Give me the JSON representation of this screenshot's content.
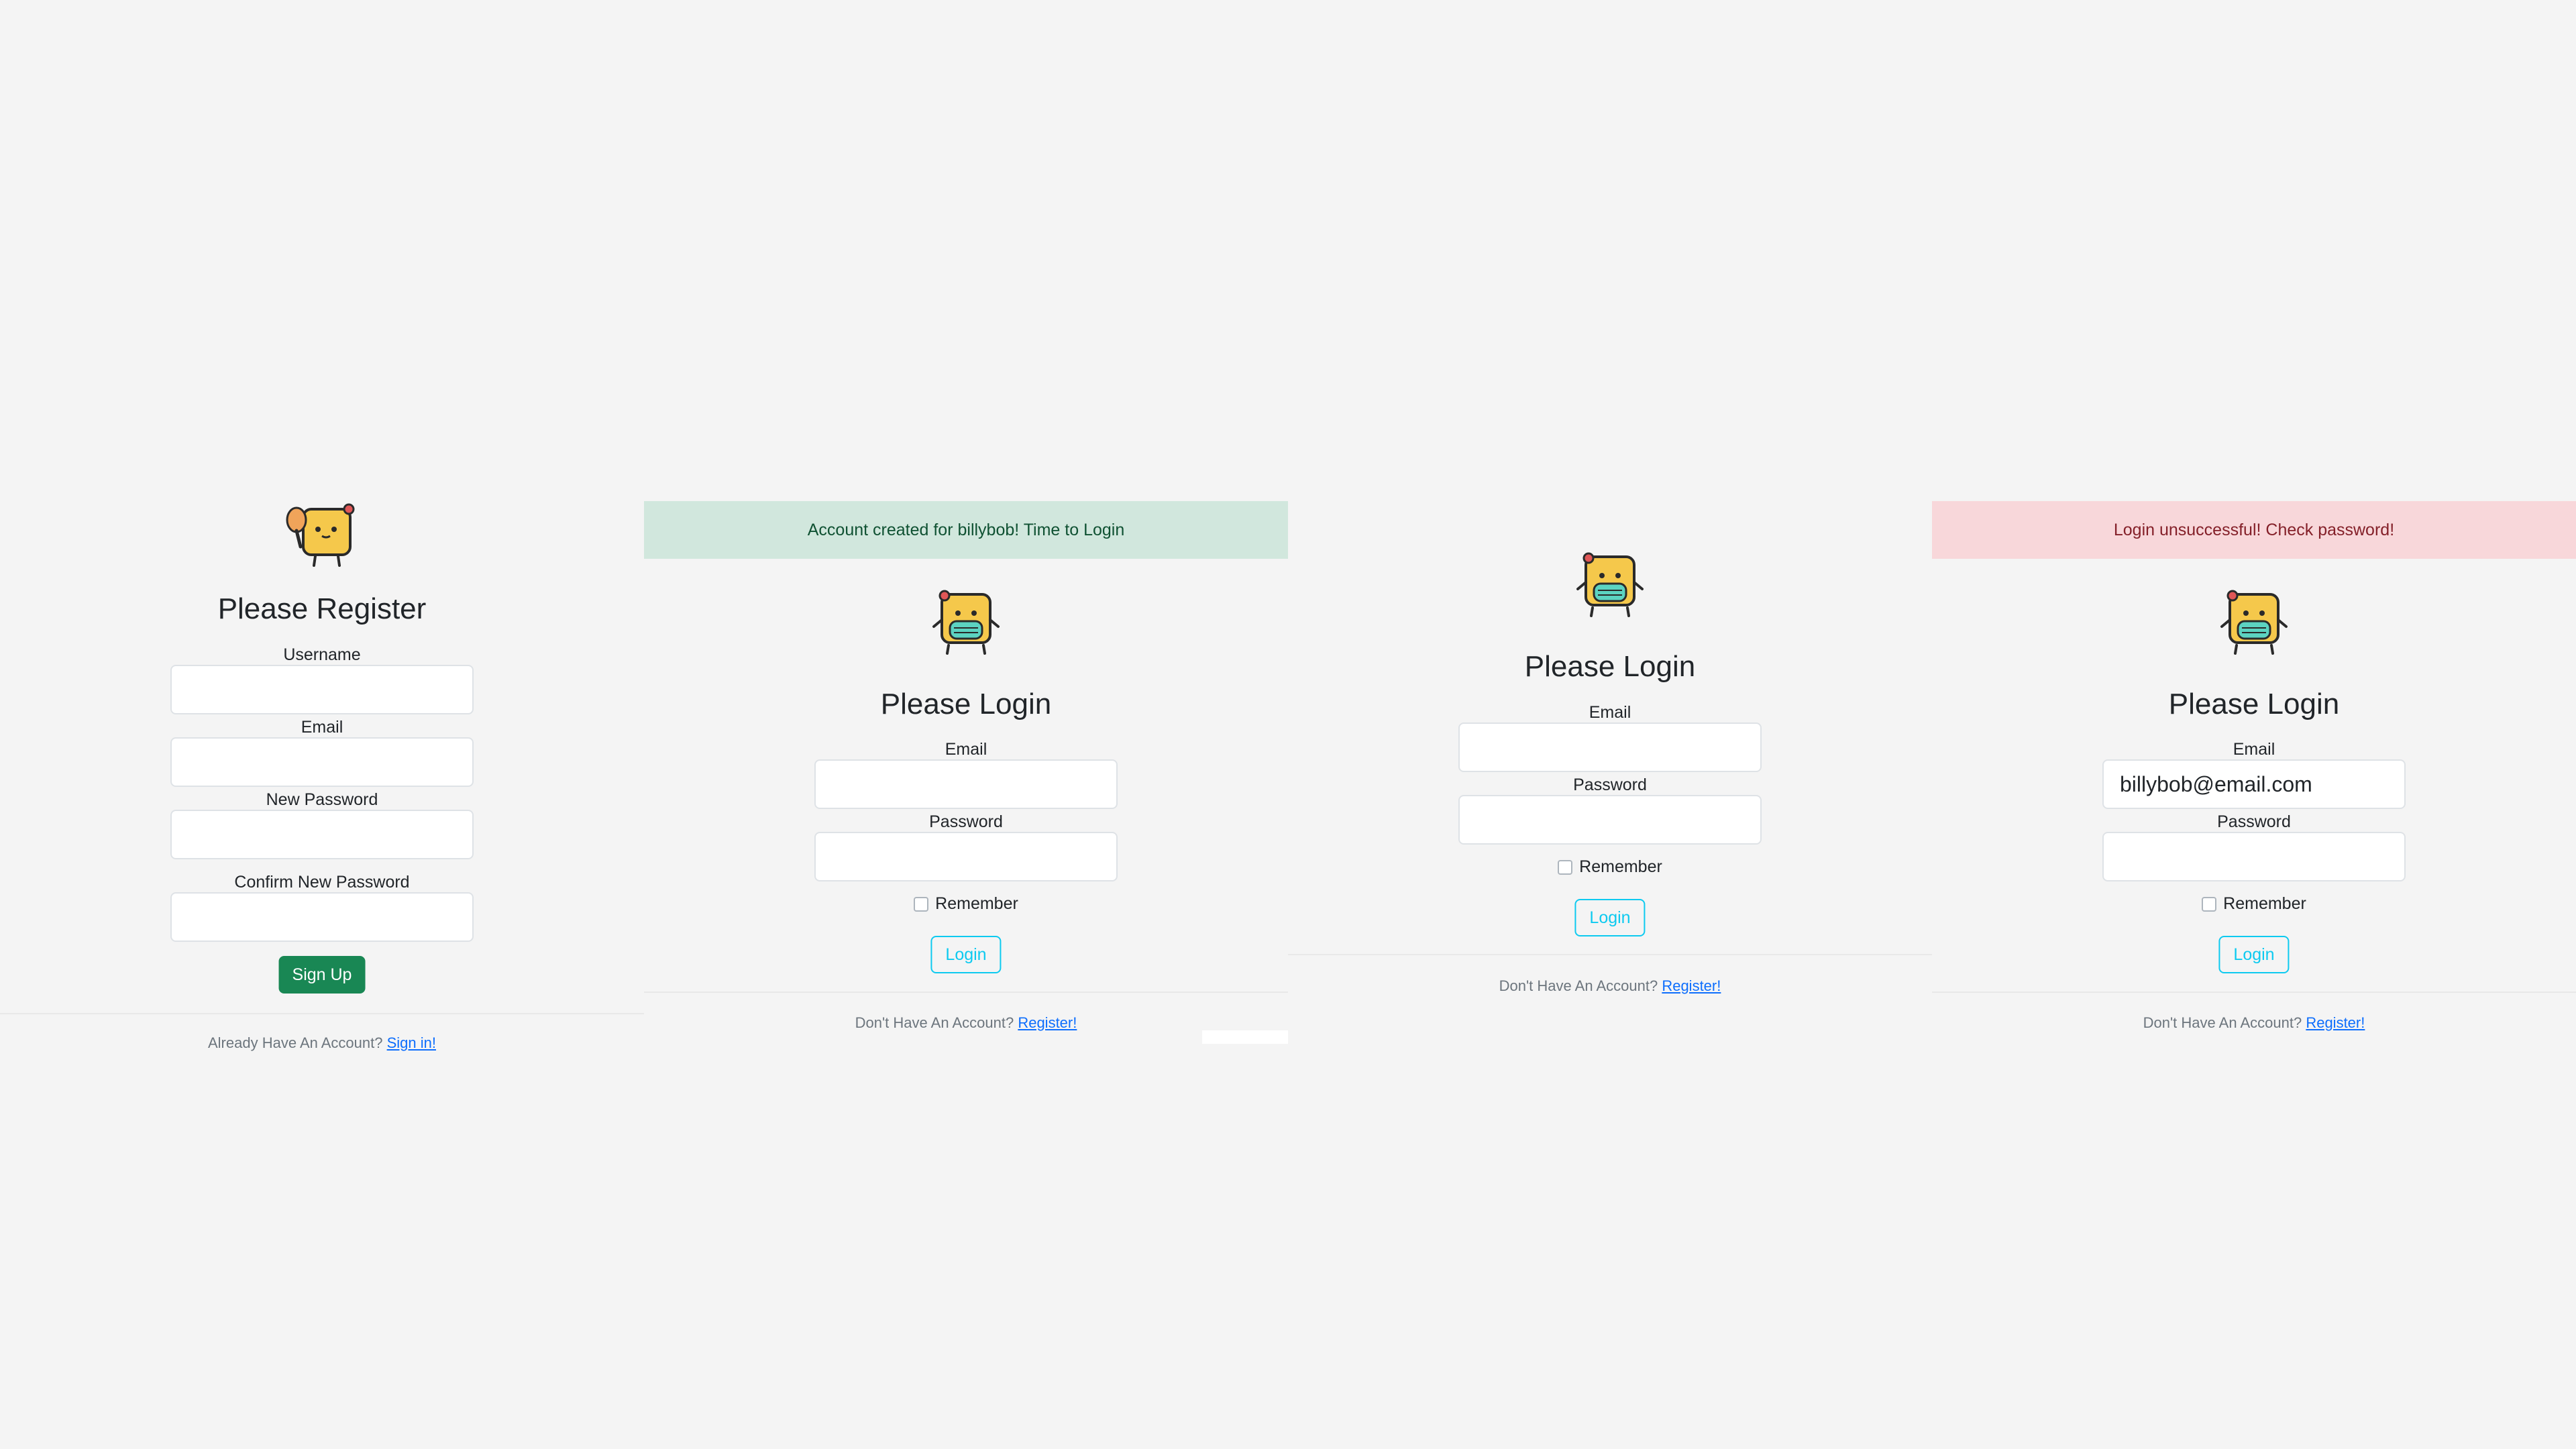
{
  "register": {
    "heading": "Please Register",
    "username_label": "Username",
    "email_label": "Email",
    "new_password_label": "New Password",
    "confirm_password_label": "Confirm New Password",
    "button": "Sign Up",
    "footer_text": "Already Have An Account?",
    "footer_link": "Sign in!"
  },
  "login_success": {
    "alert": "Account created for billybob! Time to Login",
    "heading": "Please Login",
    "email_label": "Email",
    "password_label": "Password",
    "remember_label": "Remember",
    "button": "Login",
    "footer_text": "Don't Have An Account?",
    "footer_link": "Register!"
  },
  "login_plain": {
    "heading": "Please Login",
    "email_label": "Email",
    "password_label": "Password",
    "remember_label": "Remember",
    "button": "Login",
    "footer_text": "Don't Have An Account?",
    "footer_link": "Register!"
  },
  "login_error": {
    "alert": "Login unsuccessful! Check password!",
    "heading": "Please Login",
    "email_label": "Email",
    "email_value": "billybob@email.com",
    "password_label": "Password",
    "remember_label": "Remember",
    "button": "Login",
    "footer_text": "Don't Have An Account?",
    "footer_link": "Register!"
  },
  "colors": {
    "background": "#f4f4f4",
    "success_alert": "#d1e7dd",
    "danger_alert": "#f8d7da",
    "primary_button": "#198754",
    "outline_button": "#0dcaf0",
    "link": "#0d6efd"
  },
  "icons": {
    "register_mascot": "drumstick-mascot-icon",
    "login_mascot": "mask-mascot-icon"
  }
}
